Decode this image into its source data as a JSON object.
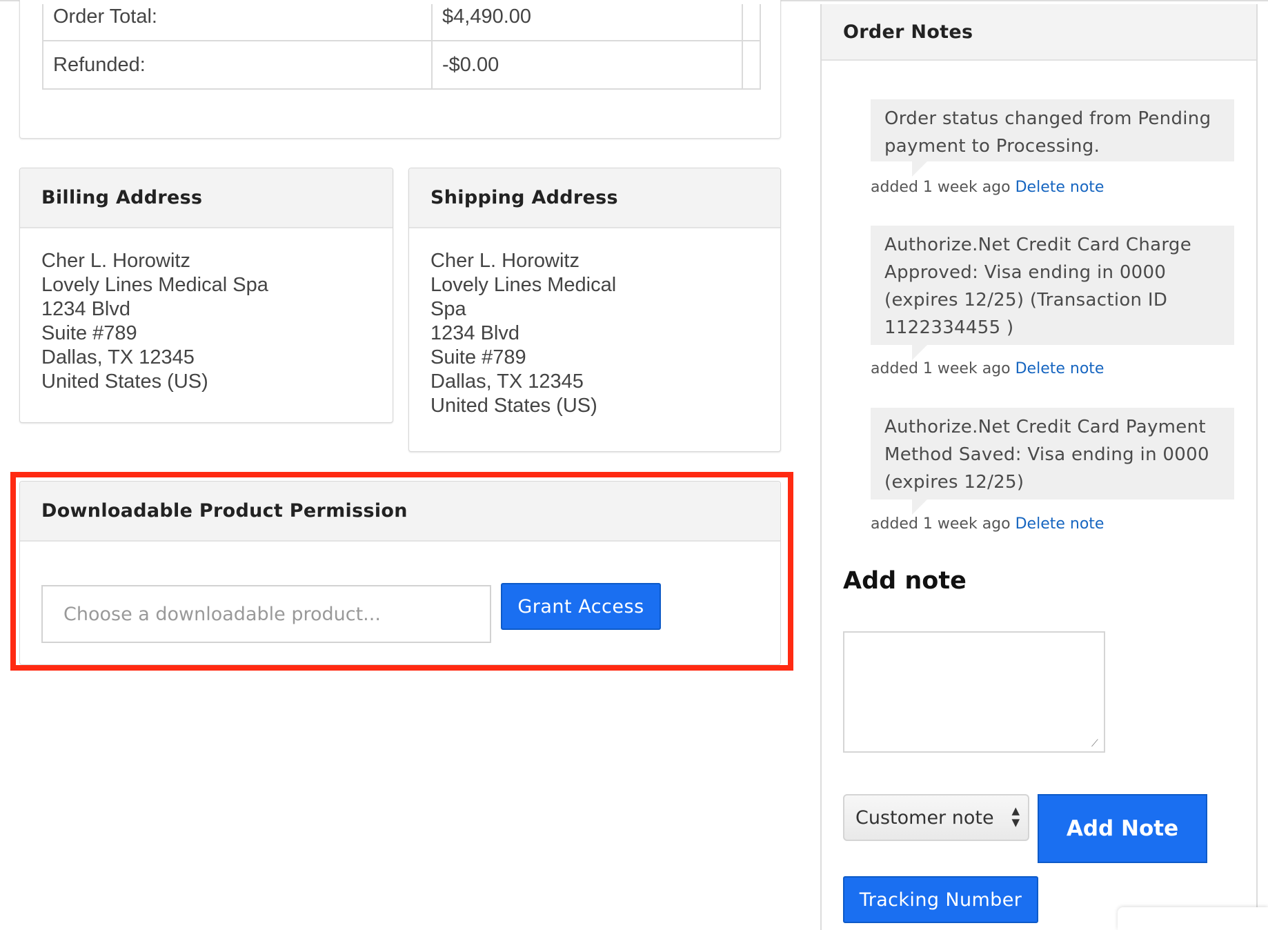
{
  "totals": {
    "order_total_label": "Order Total:",
    "order_total_value": "$4,490.00",
    "refunded_label": "Refunded:",
    "refunded_value": "-$0.00"
  },
  "billing": {
    "title": "Billing Address",
    "lines": [
      "Cher L. Horowitz",
      "Lovely Lines Medical Spa",
      "1234 Blvd",
      "Suite #789",
      "Dallas, TX 12345",
      "United States (US)"
    ]
  },
  "shipping": {
    "title": "Shipping Address",
    "lines": [
      "Cher L. Horowitz",
      "Lovely Lines Medical Spa",
      "1234 Blvd",
      "Suite #789",
      "Dallas, TX 12345",
      "United States (US)"
    ]
  },
  "downloadable": {
    "title": "Downloadable Product Permission",
    "placeholder": "Choose a downloadable product...",
    "grant_label": "Grant Access"
  },
  "order_notes": {
    "title": "Order Notes",
    "notes": [
      {
        "text": "Order status changed from Pending payment to Processing.",
        "meta": "added 1 week ago",
        "delete": "Delete note"
      },
      {
        "text": "Authorize.Net Credit Card Charge Approved: Visa ending in 0000 (expires 12/25) (Transaction ID 1122334455 )",
        "meta": "added 1 week ago",
        "delete": "Delete note"
      },
      {
        "text": "Authorize.Net Credit Card Payment Method Saved: Visa ending in 0000 (expires 12/25)",
        "meta": "added 1 week ago",
        "delete": "Delete note"
      }
    ],
    "add_note_title": "Add note",
    "note_type_selected": "Customer note",
    "add_note_button": "Add Note",
    "tracking_button": "Tracking Number"
  },
  "colors": {
    "accent_blue": "#1a6ff1",
    "refund_red": "#e8401c",
    "highlight_red": "#ff2a12",
    "link_blue": "#1665c0"
  }
}
